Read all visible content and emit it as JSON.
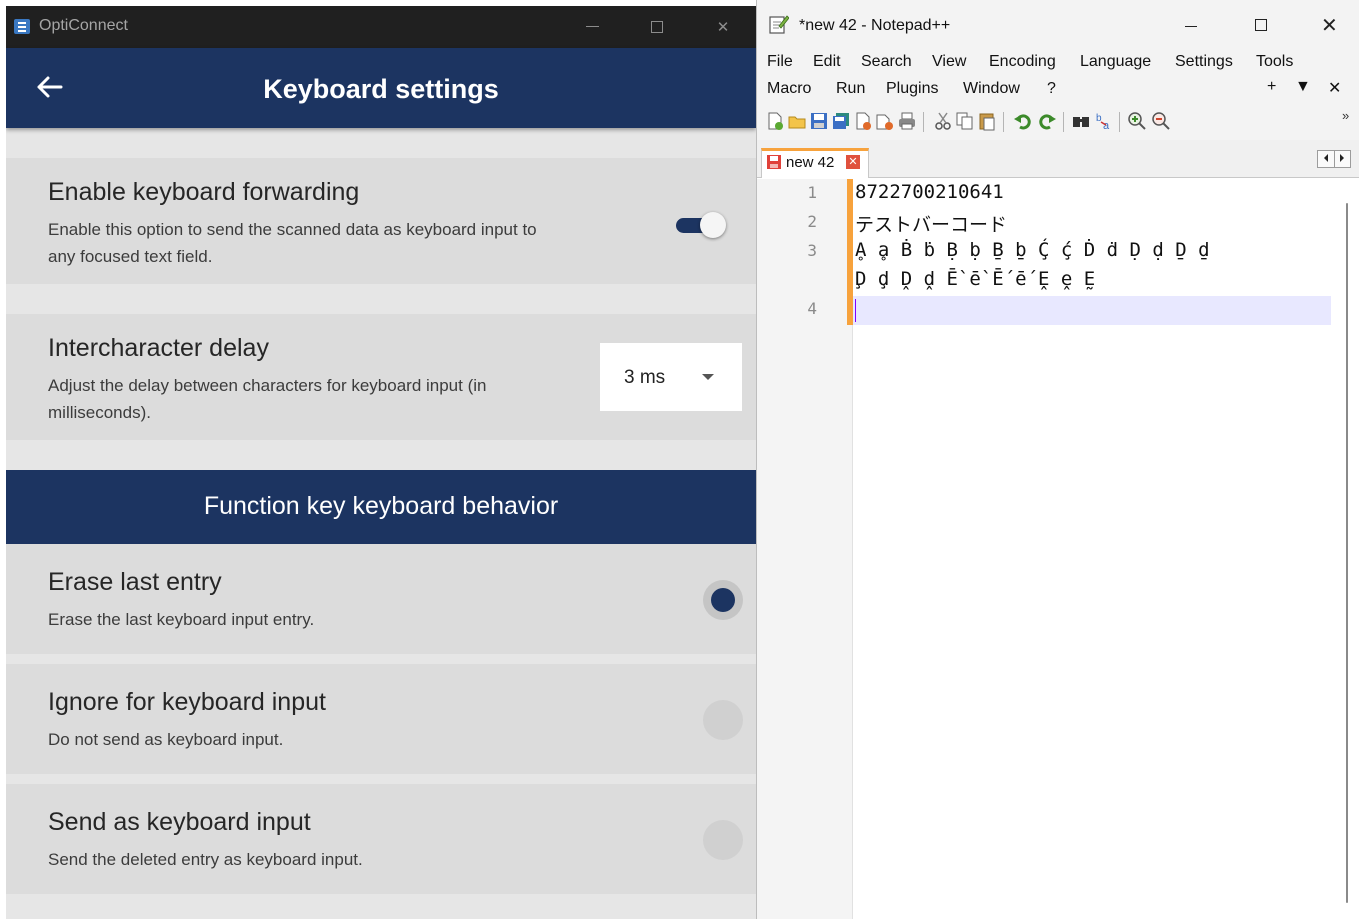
{
  "opticonnect": {
    "window_title": "OptiConnect",
    "page_title": "Keyboard settings",
    "forwarding": {
      "title": "Enable keyboard forwarding",
      "desc_line1": "Enable this option to send the scanned data as keyboard input to",
      "desc_line2": "any focused text field.",
      "enabled": true
    },
    "delay": {
      "title": "Intercharacter delay",
      "desc_line1": "Adjust the delay between characters for keyboard input (in",
      "desc_line2": "milliseconds).",
      "value": "3 ms"
    },
    "function_key_header": "Function key keyboard behavior",
    "options": [
      {
        "title": "Erase last entry",
        "desc": "Erase the last keyboard input entry.",
        "selected": true
      },
      {
        "title": "Ignore for keyboard input",
        "desc": "Do not send as keyboard input.",
        "selected": false
      },
      {
        "title": "Send as keyboard input",
        "desc": "Send the deleted entry as keyboard input.",
        "selected": false
      }
    ],
    "colors": {
      "navy": "#1c3461",
      "card": "#dcdcdc",
      "titlebar": "#202020"
    }
  },
  "notepad": {
    "window_title": "*new 42 - Notepad++",
    "menu_row1": [
      "File",
      "Edit",
      "Search",
      "View",
      "Encoding",
      "Language",
      "Settings",
      "Tools"
    ],
    "menu_row2": [
      "Macro",
      "Run",
      "Plugins",
      "Window",
      "?"
    ],
    "menu_right": [
      "+",
      "▼",
      "✕"
    ],
    "tab_label": "new 42",
    "lines": [
      {
        "number": "1",
        "text": "8722700210641"
      },
      {
        "number": "2",
        "text": "テストバーコード"
      },
      {
        "number": "3",
        "text": "Ḁ ḁ Ḃ ḃ Ḅ ḅ Ḇ ḇ Ḉ ḉ Ḋ ḋ Ḍ ḍ Ḏ ḏ"
      },
      {
        "number": "",
        "text": "Ḑ ḑ Ḓ ḓ Ḕ ḕ Ḗ ḗ Ḙ ḙ Ḛ"
      },
      {
        "number": "4",
        "text": ""
      }
    ],
    "colors": {
      "accent": "#f7a23c",
      "current_line": "#e8e8ff"
    }
  }
}
